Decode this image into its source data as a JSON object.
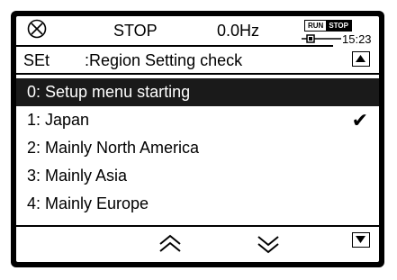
{
  "status": {
    "icon": "circle-x-icon",
    "state": "STOP",
    "frequency": "0.0Hz",
    "run_label": "RUN",
    "stop_label": "STOP",
    "time": "15:23"
  },
  "header": {
    "code": "SEt",
    "title": ":Region Setting check",
    "scroll_up_icon": "triangle-up-icon"
  },
  "menu": {
    "items": [
      {
        "label": "0: Setup menu starting",
        "selected": true,
        "checked": false
      },
      {
        "label": "1: Japan",
        "selected": false,
        "checked": true
      },
      {
        "label": "2: Mainly North America",
        "selected": false,
        "checked": false
      },
      {
        "label": "3: Mainly Asia",
        "selected": false,
        "checked": false
      },
      {
        "label": "4: Mainly Europe",
        "selected": false,
        "checked": false
      }
    ],
    "check_glyph": "✔"
  },
  "footer": {
    "up_icon": "double-chevron-up-icon",
    "down_icon": "double-chevron-down-icon",
    "scroll_down_icon": "triangle-down-icon"
  }
}
